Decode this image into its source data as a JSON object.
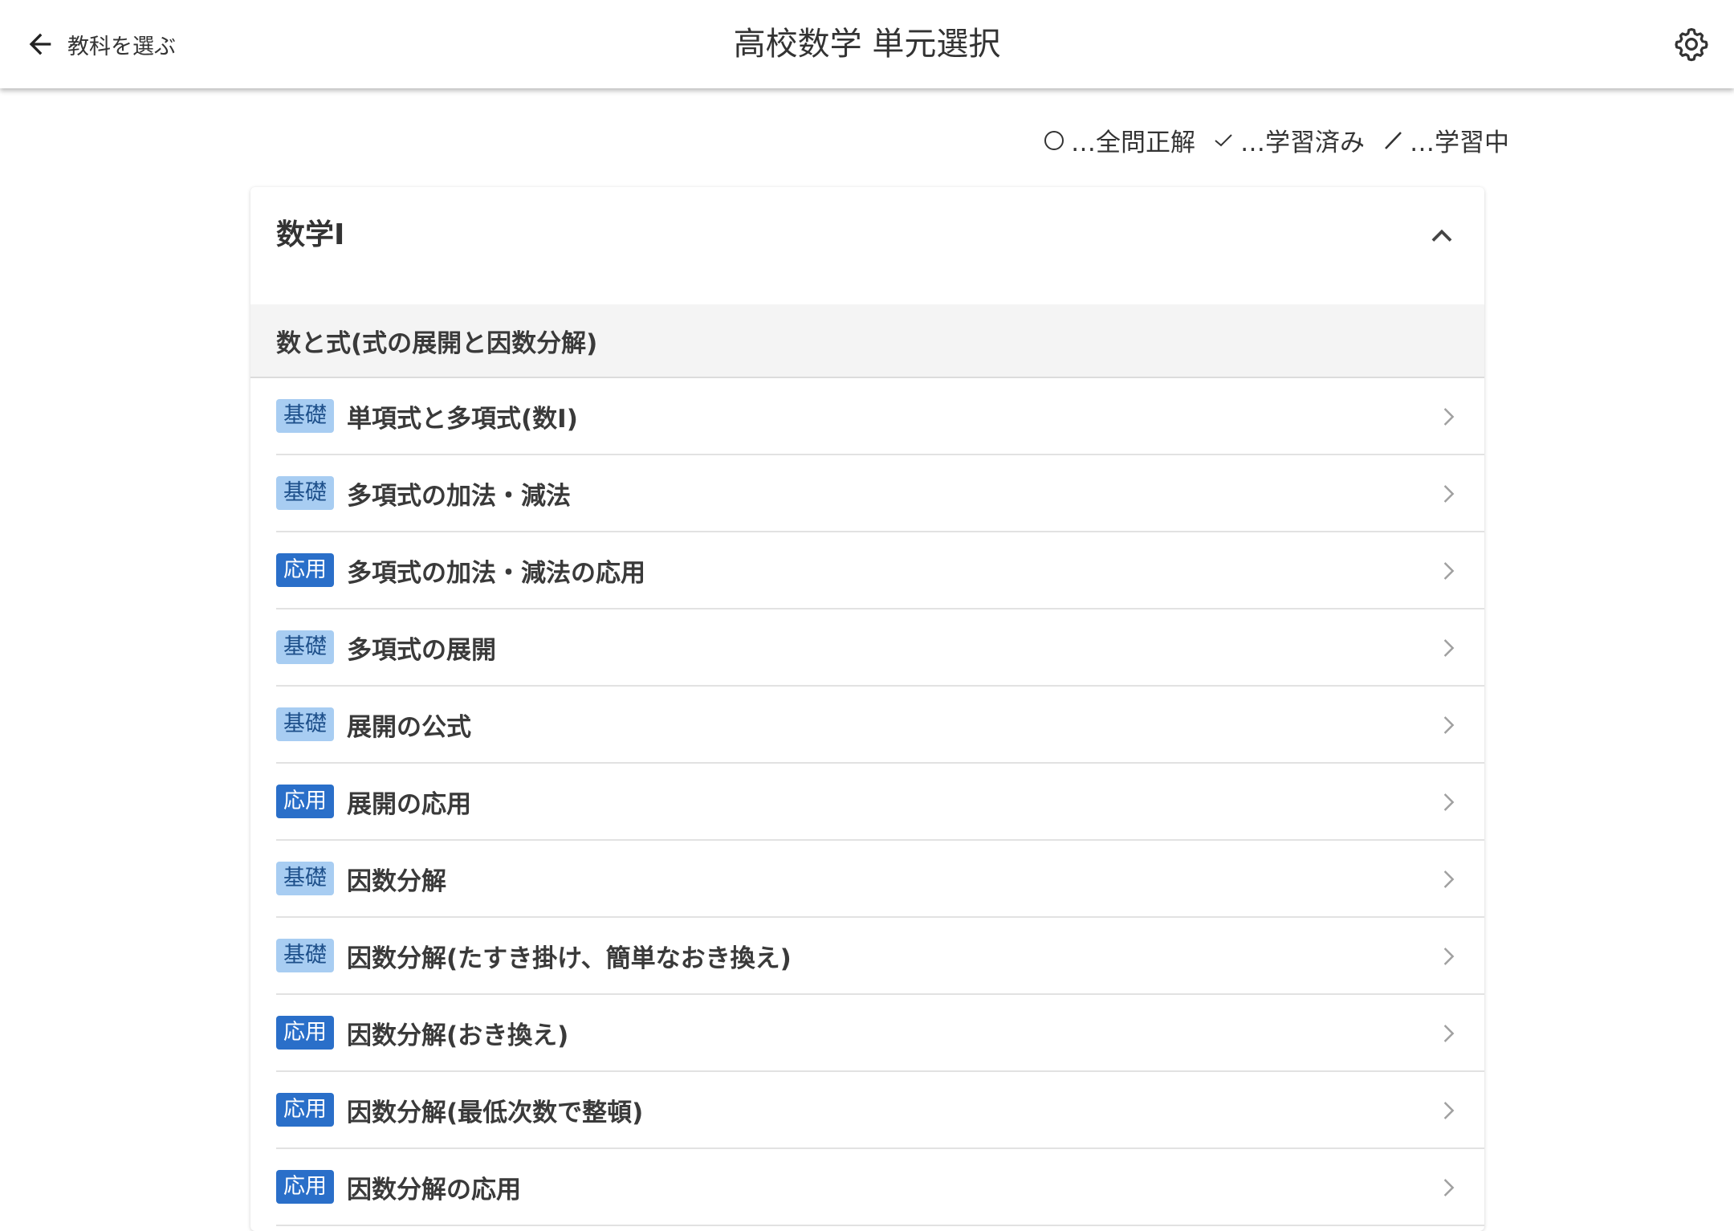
{
  "header": {
    "back_label": "教科を選ぶ",
    "title": "高校数学 単元選択"
  },
  "legend": {
    "all_correct": "…全問正解",
    "studied": "…学習済み",
    "in_progress": "…学習中"
  },
  "colors": {
    "badge_basic_bg": "#a8cdf2",
    "badge_basic_text": "#1d4f8a",
    "badge_applied_bg": "#2a6fc9",
    "badge_applied_text": "#ffffff"
  },
  "card": {
    "title": "数学I",
    "section": "数と式(式の展開と因数分解)",
    "units": [
      {
        "level": "基礎",
        "kind": "basic",
        "label": "単項式と多項式(数I)"
      },
      {
        "level": "基礎",
        "kind": "basic",
        "label": "多項式の加法・減法"
      },
      {
        "level": "応用",
        "kind": "applied",
        "label": "多項式の加法・減法の応用"
      },
      {
        "level": "基礎",
        "kind": "basic",
        "label": "多項式の展開"
      },
      {
        "level": "基礎",
        "kind": "basic",
        "label": "展開の公式"
      },
      {
        "level": "応用",
        "kind": "applied",
        "label": "展開の応用"
      },
      {
        "level": "基礎",
        "kind": "basic",
        "label": "因数分解"
      },
      {
        "level": "基礎",
        "kind": "basic",
        "label": "因数分解(たすき掛け、簡単なおき換え)"
      },
      {
        "level": "応用",
        "kind": "applied",
        "label": "因数分解(おき換え)"
      },
      {
        "level": "応用",
        "kind": "applied",
        "label": "因数分解(最低次数で整頓)"
      },
      {
        "level": "応用",
        "kind": "applied",
        "label": "因数分解の応用"
      }
    ]
  }
}
